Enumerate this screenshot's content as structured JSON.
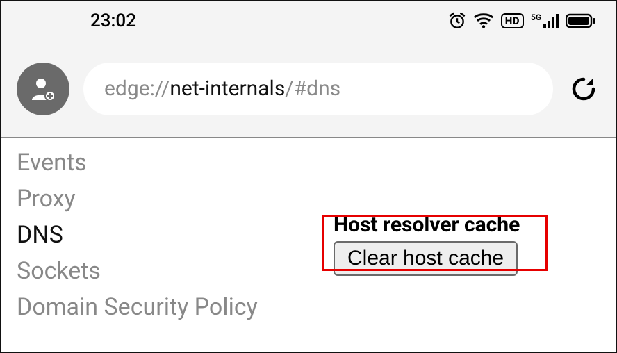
{
  "status": {
    "time": "23:02",
    "icons": {
      "alarm": "alarm-icon",
      "wifi": "wifi-icon",
      "hd": "HD",
      "network_label": "5G",
      "battery": "battery-icon"
    }
  },
  "browser": {
    "url_prefix": "edge://",
    "url_host": "net-internals",
    "url_suffix": "/#dns"
  },
  "sidebar": {
    "items": [
      {
        "label": "Events",
        "active": false
      },
      {
        "label": "Proxy",
        "active": false
      },
      {
        "label": "DNS",
        "active": true
      },
      {
        "label": "Sockets",
        "active": false
      },
      {
        "label": "Domain Security Policy",
        "active": false
      }
    ]
  },
  "main": {
    "section_title": "Host resolver cache",
    "clear_button": "Clear host cache"
  }
}
